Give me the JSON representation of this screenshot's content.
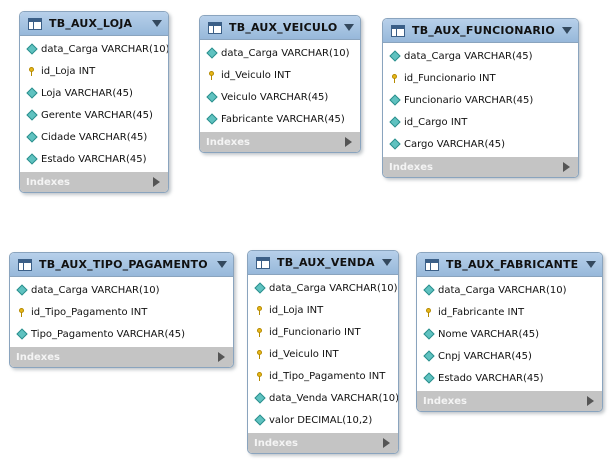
{
  "indexes_label": "Indexes",
  "tables": [
    {
      "name": "TB_AUX_LOJA",
      "columns": [
        {
          "text": "data_Carga VARCHAR(10)",
          "key": false
        },
        {
          "text": "id_Loja INT",
          "key": true
        },
        {
          "text": "Loja VARCHAR(45)",
          "key": false
        },
        {
          "text": "Gerente VARCHAR(45)",
          "key": false
        },
        {
          "text": "Cidade VARCHAR(45)",
          "key": false
        },
        {
          "text": "Estado VARCHAR(45)",
          "key": false
        }
      ]
    },
    {
      "name": "TB_AUX_VEICULO",
      "columns": [
        {
          "text": "data_Carga VARCHAR(10)",
          "key": false
        },
        {
          "text": "id_Veiculo INT",
          "key": true
        },
        {
          "text": "Veiculo VARCHAR(45)",
          "key": false
        },
        {
          "text": "Fabricante VARCHAR(45)",
          "key": false
        }
      ]
    },
    {
      "name": "TB_AUX_FUNCIONARIO",
      "columns": [
        {
          "text": "data_Carga VARCHAR(45)",
          "key": false
        },
        {
          "text": "id_Funcionario INT",
          "key": true
        },
        {
          "text": "Funcionario VARCHAR(45)",
          "key": false
        },
        {
          "text": "id_Cargo INT",
          "key": false
        },
        {
          "text": "Cargo VARCHAR(45)",
          "key": false
        }
      ]
    },
    {
      "name": "TB_AUX_TIPO_PAGAMENTO",
      "columns": [
        {
          "text": "data_Carga VARCHAR(10)",
          "key": false
        },
        {
          "text": "id_Tipo_Pagamento INT",
          "key": true
        },
        {
          "text": "Tipo_Pagamento VARCHAR(45)",
          "key": false
        }
      ]
    },
    {
      "name": "TB_AUX_VENDA",
      "columns": [
        {
          "text": "data_Carga VARCHAR(10)",
          "key": false
        },
        {
          "text": "id_Loja INT",
          "key": true
        },
        {
          "text": "id_Funcionario INT",
          "key": true
        },
        {
          "text": "id_Veiculo INT",
          "key": true
        },
        {
          "text": "id_Tipo_Pagamento INT",
          "key": true
        },
        {
          "text": "data_Venda VARCHAR(10)",
          "key": false
        },
        {
          "text": "valor DECIMAL(10,2)",
          "key": false
        }
      ]
    },
    {
      "name": "TB_AUX_FABRICANTE",
      "columns": [
        {
          "text": "data_Carga VARCHAR(10)",
          "key": false
        },
        {
          "text": "id_Fabricante INT",
          "key": true
        },
        {
          "text": "Nome VARCHAR(45)",
          "key": false
        },
        {
          "text": "Cnpj VARCHAR(45)",
          "key": false
        },
        {
          "text": "Estado VARCHAR(45)",
          "key": false
        }
      ]
    }
  ]
}
